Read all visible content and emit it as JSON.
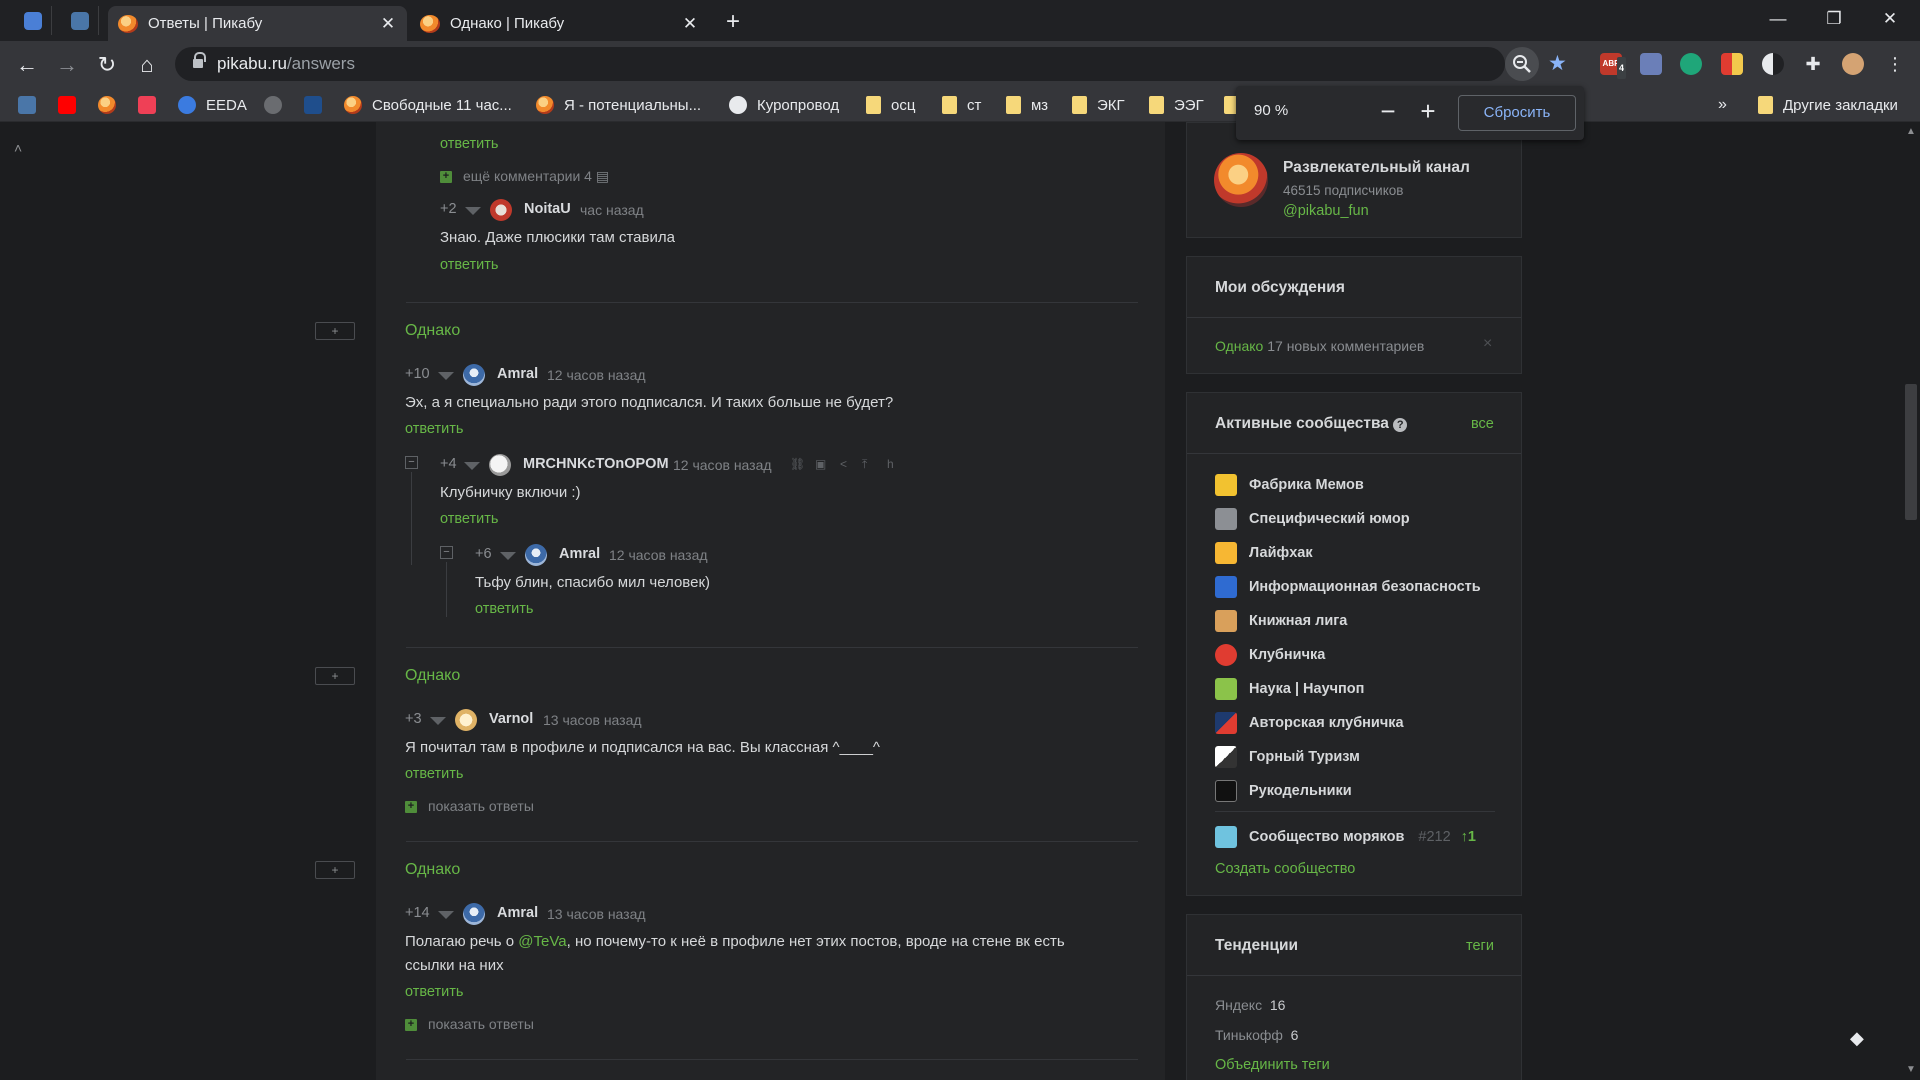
{
  "browser": {
    "tabs": [
      {
        "title": "Ответы | Пикабу",
        "active": true
      },
      {
        "title": "Однако | Пикабу",
        "active": false
      }
    ],
    "url_host": "pikabu.ru",
    "url_path": "/answers",
    "zoom": {
      "value": "90 %",
      "minus": "−",
      "plus": "+",
      "reset": "Сбросить"
    },
    "bookmarks": [
      {
        "label": "EEDA"
      },
      {
        "label": "Свободные 11 час..."
      },
      {
        "label": "Я - потенциальны..."
      },
      {
        "label": "Куропровод"
      },
      {
        "label": "осц"
      },
      {
        "label": "ст"
      },
      {
        "label": "мз"
      },
      {
        "label": "ЭКГ"
      },
      {
        "label": "ЭЭГ"
      }
    ],
    "more_bookmarks": "»",
    "other_bookmarks": "Другие закладки",
    "abp_badge": "4"
  },
  "feed": {
    "reply_label": "ответить",
    "more_comments": "ещё комментарии 4",
    "show_replies": "показать ответы",
    "top": {
      "rating": "+2",
      "nick": "NoitaU",
      "time": "час назад",
      "text": "Знаю. Даже плюсики там ставила"
    },
    "blocks": [
      {
        "post": "Однако",
        "comments": [
          {
            "rating": "+10",
            "nick": "Amral",
            "time": "12 часов назад",
            "text": "Эх, а я специально ради этого подписался. И таких больше не будет?"
          },
          {
            "rating": "+4",
            "nick": "MRCHNKcTOnOPOM",
            "time": "12 часов назад",
            "text": "Клубничку включи :)"
          },
          {
            "rating": "+6",
            "nick": "Amral",
            "time": "12 часов назад",
            "text": "Тьфу блин, спасибо мил человек)"
          }
        ]
      },
      {
        "post": "Однако",
        "comments": [
          {
            "rating": "+3",
            "nick": "Varnol",
            "time": "13 часов назад",
            "text": "Я почитал там в профиле и подписался на вас. Вы классная ^____^"
          }
        ]
      },
      {
        "post": "Однако",
        "comments": [
          {
            "rating": "+14",
            "nick": "Amral",
            "time": "13 часов назад",
            "text_before": "Полагаю речь о ",
            "mention": "@TeVa",
            "text_after": ", но почему-то к неё в профиле нет этих постов, вроде на стене вк есть",
            "text_line2": "ссылки на них"
          }
        ]
      }
    ]
  },
  "sidebar": {
    "channel": {
      "name": "Развлекательный канал",
      "subs": "46515 подписчиков",
      "handle": "@pikabu_fun"
    },
    "discussions": {
      "title": "Мои обсуждения",
      "item_link": "Однако",
      "item_text": "17 новых комментариев",
      "close": "×"
    },
    "communities": {
      "title": "Активные сообщества",
      "help": "?",
      "all": "все",
      "items": [
        "Фабрика Мемов",
        "Специфический юмор",
        "Лайфхак",
        "Информационная безопасность",
        "Книжная лига",
        "Клубничка",
        "Наука | Научпоп",
        "Авторская клубничка",
        "Горный Туризм",
        "Рукодельники"
      ],
      "featured": {
        "name": "Сообщество моряков",
        "rank": "#212",
        "up": "↑1"
      },
      "create": "Создать сообщество"
    },
    "trends": {
      "title": "Тенденции",
      "tags_link": "теги",
      "items": [
        {
          "name": "Яндекс",
          "count": "16"
        },
        {
          "name": "Тинькофф",
          "count": "6"
        }
      ],
      "merge": "Объединить теги"
    }
  },
  "colors": {
    "accent_green": "#67b747",
    "bg": "#1c1d1f",
    "panel": "#232426"
  }
}
